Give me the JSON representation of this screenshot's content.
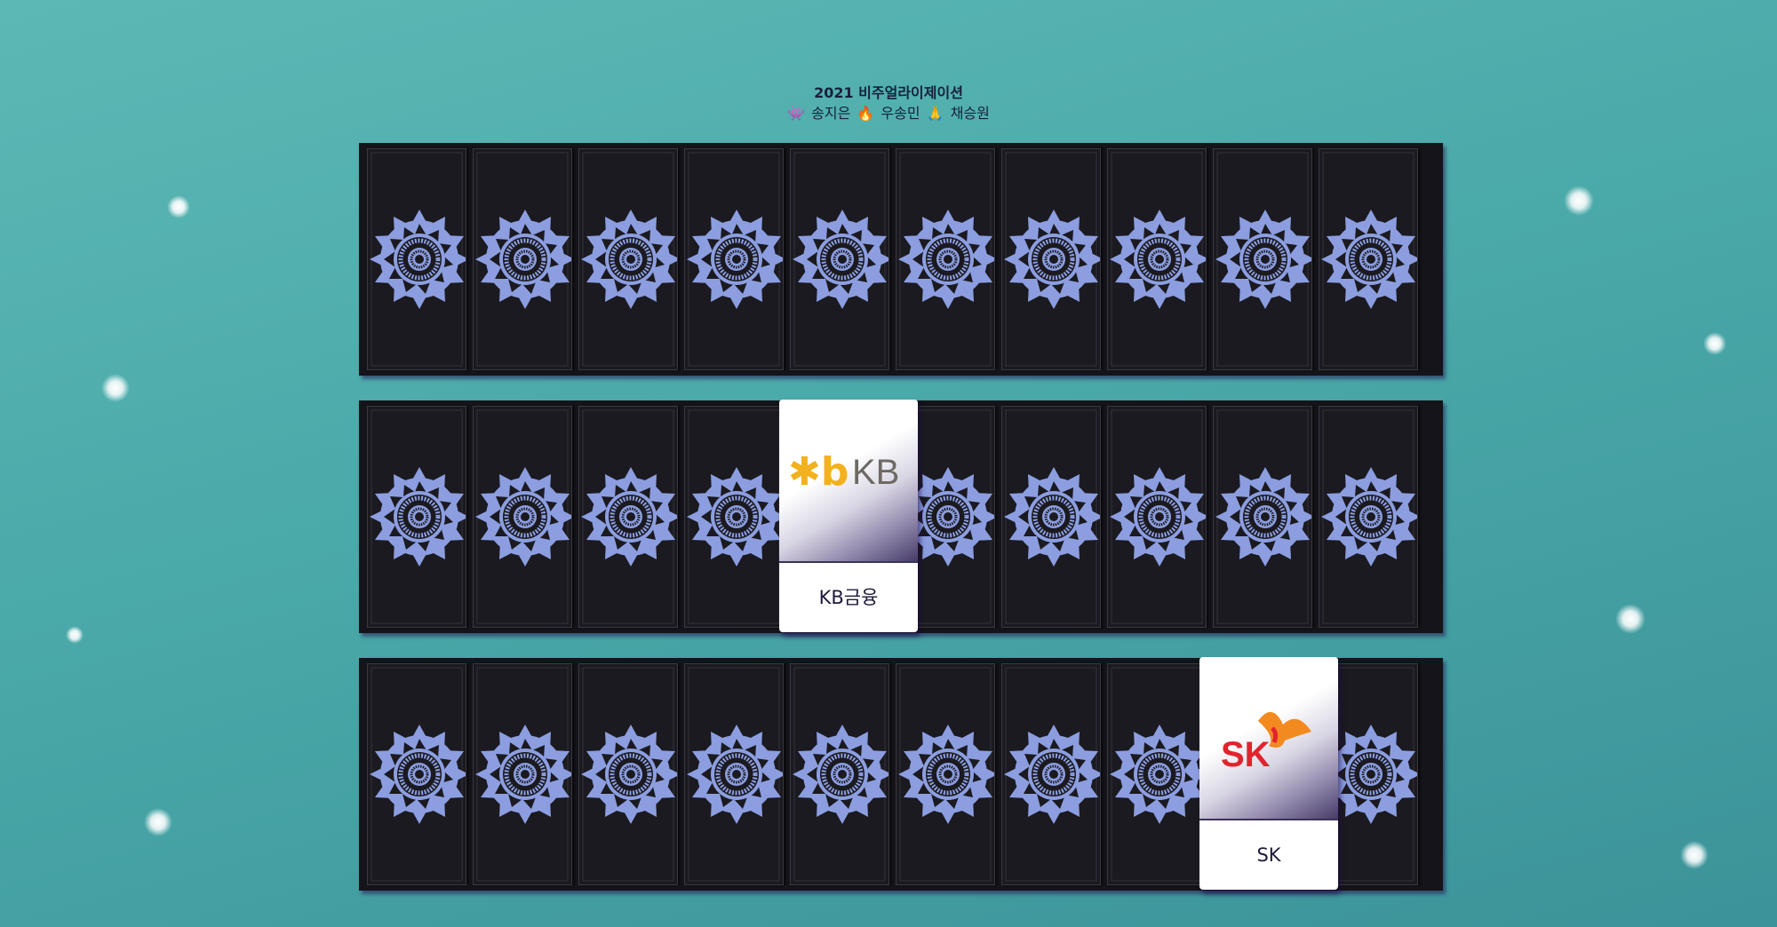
{
  "header": {
    "title": "2021 비주얼라이제이션",
    "credits": [
      {
        "icon": "alien-monster-emoji",
        "emoji": "👾",
        "name": "송지은"
      },
      {
        "icon": "fire-emoji",
        "emoji": "🔥",
        "name": "우송민"
      },
      {
        "icon": "folded-hands-emoji",
        "emoji": "🙏",
        "name": "채승원"
      }
    ]
  },
  "board": {
    "rows": 3,
    "cards_per_row": 10,
    "card_back_icon": "tarot-sun-moon-card-back",
    "card_back_colors": {
      "background": "#1b1a20",
      "motif": "#8c9ee0"
    },
    "revealed": [
      {
        "row": 2,
        "card": 5,
        "name": "KB금융",
        "logo": {
          "icon": "kb-logo",
          "mark": "✱b",
          "text": "KB",
          "mark_color": "#f2b11e",
          "text_color": "#6e6a63"
        }
      },
      {
        "row": 3,
        "card": 9,
        "name": "SK",
        "logo": {
          "icon": "sk-butterfly-logo",
          "text": "SK",
          "text_color": "#e0242e",
          "wing_color": "#f28a1f"
        }
      }
    ]
  }
}
